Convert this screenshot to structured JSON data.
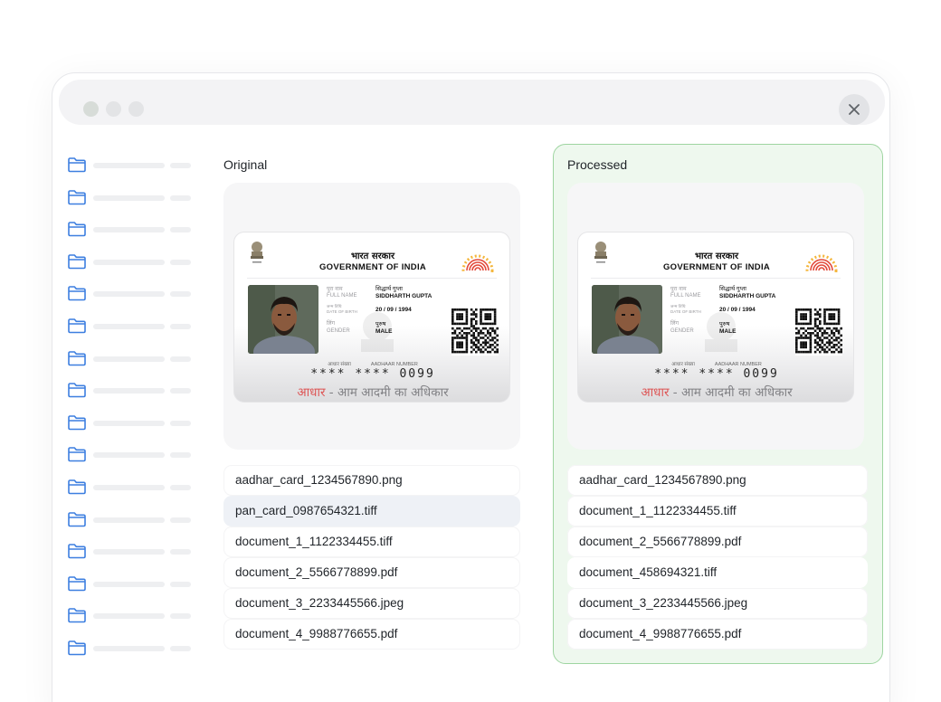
{
  "window": {
    "controls": [
      "traffic-light-dot",
      "traffic-light-dot",
      "traffic-light-dot"
    ],
    "close_icon": "close-icon"
  },
  "sidebar": {
    "item_count": 16,
    "icon": "folder-icon",
    "accent_color": "#3d7fe0"
  },
  "original": {
    "label": "Original",
    "card": {
      "hindi_title": "भारत सरकार",
      "title": "GOVERNMENT OF INDIA",
      "name_label_hi": "पूरा नाम",
      "name_label": "FULL NAME",
      "name_hi": "सिद्धार्थ गुप्ता",
      "name": "SIDDHARTH GUPTA",
      "dob_label_hi": "जन्म तिथि",
      "dob_label": "DATE OF BIRTH",
      "dob": "20 / 09 / 1994",
      "gender_label_hi": "लिंग",
      "gender_label": "GENDER",
      "gender_hi": "पुरुष",
      "gender": "MALE",
      "number_label_hi": "आधार संख्या",
      "number_label": "AADHAAR NUMBER",
      "number": "**** **** 0099",
      "tagline_red": "आधार",
      "tagline_rest": " - आम आदमी का अधिकार"
    },
    "files": [
      "aadhar_card_1234567890.png",
      "pan_card_0987654321.tiff",
      "document_1_1122334455.tiff",
      "document_2_5566778899.pdf",
      "document_3_2233445566.jpeg",
      "document_4_9988776655.pdf"
    ],
    "selected_index": 1
  },
  "processed": {
    "label": "Processed",
    "accent_color": "#9ed5a1",
    "card": {
      "hindi_title": "भारत सरकार",
      "title": "GOVERNMENT OF INDIA",
      "name_label_hi": "पूरा नाम",
      "name_label": "FULL NAME",
      "name_hi": "सिद्धार्थ गुप्ता",
      "name": "SIDDHARTH GUPTA",
      "dob_label_hi": "जन्म तिथि",
      "dob_label": "DATE OF BIRTH",
      "dob": "20 / 09 / 1994",
      "gender_label_hi": "लिंग",
      "gender_label": "GENDER",
      "gender_hi": "पुरुष",
      "gender": "MALE",
      "number_label_hi": "आधार संख्या",
      "number_label": "AADHAAR NUMBER",
      "number": "**** **** 0099",
      "tagline_red": "आधार",
      "tagline_rest": " - आम आदमी का अधिकार"
    },
    "files": [
      "aadhar_card_1234567890.png",
      "document_1_1122334455.tiff",
      "document_2_5566778899.pdf",
      "document_458694321.tiff",
      "document_3_2233445566.jpeg",
      "document_4_9988776655.pdf"
    ],
    "selected_index": 3
  }
}
